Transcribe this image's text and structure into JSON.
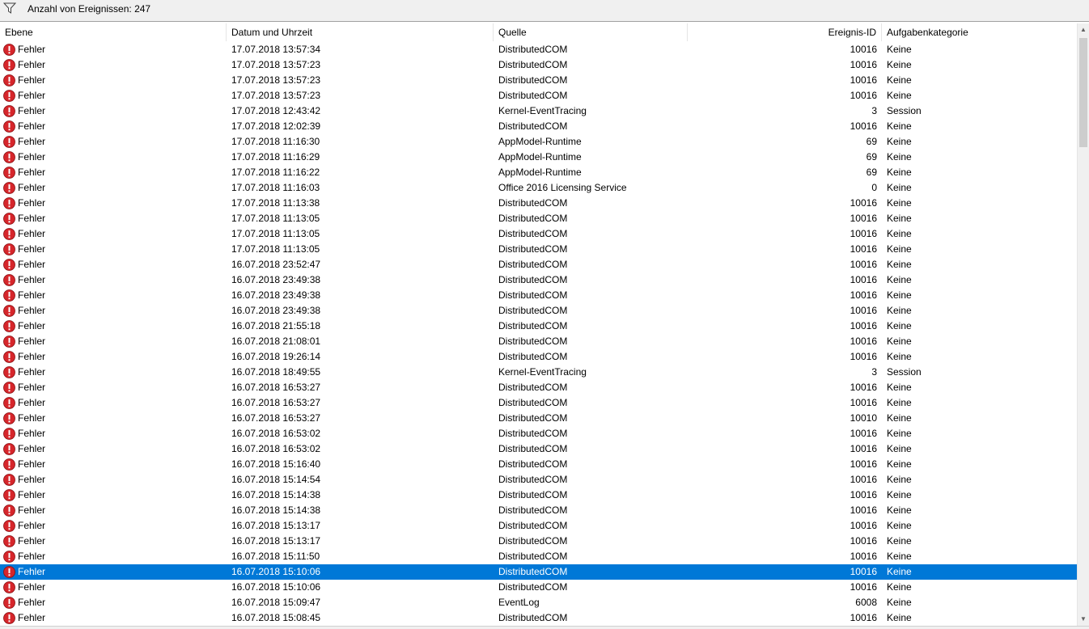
{
  "toolbar": {
    "count_label": "Anzahl von Ereignissen: 247",
    "filter_icon": "filter-icon"
  },
  "columns": {
    "level": "Ebene",
    "date": "Datum und Uhrzeit",
    "source": "Quelle",
    "event_id": "Ereignis-ID",
    "category": "Aufgabenkategorie"
  },
  "colors": {
    "selection": "#0078d7",
    "error_icon": "#d6262b"
  },
  "selected_index": 34,
  "rows": [
    {
      "level": "Fehler",
      "date": "17.07.2018 13:57:34",
      "source": "DistributedCOM",
      "id": "10016",
      "category": "Keine"
    },
    {
      "level": "Fehler",
      "date": "17.07.2018 13:57:23",
      "source": "DistributedCOM",
      "id": "10016",
      "category": "Keine"
    },
    {
      "level": "Fehler",
      "date": "17.07.2018 13:57:23",
      "source": "DistributedCOM",
      "id": "10016",
      "category": "Keine"
    },
    {
      "level": "Fehler",
      "date": "17.07.2018 13:57:23",
      "source": "DistributedCOM",
      "id": "10016",
      "category": "Keine"
    },
    {
      "level": "Fehler",
      "date": "17.07.2018 12:43:42",
      "source": "Kernel-EventTracing",
      "id": "3",
      "category": "Session"
    },
    {
      "level": "Fehler",
      "date": "17.07.2018 12:02:39",
      "source": "DistributedCOM",
      "id": "10016",
      "category": "Keine"
    },
    {
      "level": "Fehler",
      "date": "17.07.2018 11:16:30",
      "source": "AppModel-Runtime",
      "id": "69",
      "category": "Keine"
    },
    {
      "level": "Fehler",
      "date": "17.07.2018 11:16:29",
      "source": "AppModel-Runtime",
      "id": "69",
      "category": "Keine"
    },
    {
      "level": "Fehler",
      "date": "17.07.2018 11:16:22",
      "source": "AppModel-Runtime",
      "id": "69",
      "category": "Keine"
    },
    {
      "level": "Fehler",
      "date": "17.07.2018 11:16:03",
      "source": "Office 2016 Licensing Service",
      "id": "0",
      "category": "Keine"
    },
    {
      "level": "Fehler",
      "date": "17.07.2018 11:13:38",
      "source": "DistributedCOM",
      "id": "10016",
      "category": "Keine"
    },
    {
      "level": "Fehler",
      "date": "17.07.2018 11:13:05",
      "source": "DistributedCOM",
      "id": "10016",
      "category": "Keine"
    },
    {
      "level": "Fehler",
      "date": "17.07.2018 11:13:05",
      "source": "DistributedCOM",
      "id": "10016",
      "category": "Keine"
    },
    {
      "level": "Fehler",
      "date": "17.07.2018 11:13:05",
      "source": "DistributedCOM",
      "id": "10016",
      "category": "Keine"
    },
    {
      "level": "Fehler",
      "date": "16.07.2018 23:52:47",
      "source": "DistributedCOM",
      "id": "10016",
      "category": "Keine"
    },
    {
      "level": "Fehler",
      "date": "16.07.2018 23:49:38",
      "source": "DistributedCOM",
      "id": "10016",
      "category": "Keine"
    },
    {
      "level": "Fehler",
      "date": "16.07.2018 23:49:38",
      "source": "DistributedCOM",
      "id": "10016",
      "category": "Keine"
    },
    {
      "level": "Fehler",
      "date": "16.07.2018 23:49:38",
      "source": "DistributedCOM",
      "id": "10016",
      "category": "Keine"
    },
    {
      "level": "Fehler",
      "date": "16.07.2018 21:55:18",
      "source": "DistributedCOM",
      "id": "10016",
      "category": "Keine"
    },
    {
      "level": "Fehler",
      "date": "16.07.2018 21:08:01",
      "source": "DistributedCOM",
      "id": "10016",
      "category": "Keine"
    },
    {
      "level": "Fehler",
      "date": "16.07.2018 19:26:14",
      "source": "DistributedCOM",
      "id": "10016",
      "category": "Keine"
    },
    {
      "level": "Fehler",
      "date": "16.07.2018 18:49:55",
      "source": "Kernel-EventTracing",
      "id": "3",
      "category": "Session"
    },
    {
      "level": "Fehler",
      "date": "16.07.2018 16:53:27",
      "source": "DistributedCOM",
      "id": "10016",
      "category": "Keine"
    },
    {
      "level": "Fehler",
      "date": "16.07.2018 16:53:27",
      "source": "DistributedCOM",
      "id": "10016",
      "category": "Keine"
    },
    {
      "level": "Fehler",
      "date": "16.07.2018 16:53:27",
      "source": "DistributedCOM",
      "id": "10010",
      "category": "Keine"
    },
    {
      "level": "Fehler",
      "date": "16.07.2018 16:53:02",
      "source": "DistributedCOM",
      "id": "10016",
      "category": "Keine"
    },
    {
      "level": "Fehler",
      "date": "16.07.2018 16:53:02",
      "source": "DistributedCOM",
      "id": "10016",
      "category": "Keine"
    },
    {
      "level": "Fehler",
      "date": "16.07.2018 15:16:40",
      "source": "DistributedCOM",
      "id": "10016",
      "category": "Keine"
    },
    {
      "level": "Fehler",
      "date": "16.07.2018 15:14:54",
      "source": "DistributedCOM",
      "id": "10016",
      "category": "Keine"
    },
    {
      "level": "Fehler",
      "date": "16.07.2018 15:14:38",
      "source": "DistributedCOM",
      "id": "10016",
      "category": "Keine"
    },
    {
      "level": "Fehler",
      "date": "16.07.2018 15:14:38",
      "source": "DistributedCOM",
      "id": "10016",
      "category": "Keine"
    },
    {
      "level": "Fehler",
      "date": "16.07.2018 15:13:17",
      "source": "DistributedCOM",
      "id": "10016",
      "category": "Keine"
    },
    {
      "level": "Fehler",
      "date": "16.07.2018 15:13:17",
      "source": "DistributedCOM",
      "id": "10016",
      "category": "Keine"
    },
    {
      "level": "Fehler",
      "date": "16.07.2018 15:11:50",
      "source": "DistributedCOM",
      "id": "10016",
      "category": "Keine"
    },
    {
      "level": "Fehler",
      "date": "16.07.2018 15:10:06",
      "source": "DistributedCOM",
      "id": "10016",
      "category": "Keine"
    },
    {
      "level": "Fehler",
      "date": "16.07.2018 15:10:06",
      "source": "DistributedCOM",
      "id": "10016",
      "category": "Keine"
    },
    {
      "level": "Fehler",
      "date": "16.07.2018 15:09:47",
      "source": "EventLog",
      "id": "6008",
      "category": "Keine"
    },
    {
      "level": "Fehler",
      "date": "16.07.2018 15:08:45",
      "source": "DistributedCOM",
      "id": "10016",
      "category": "Keine"
    }
  ]
}
